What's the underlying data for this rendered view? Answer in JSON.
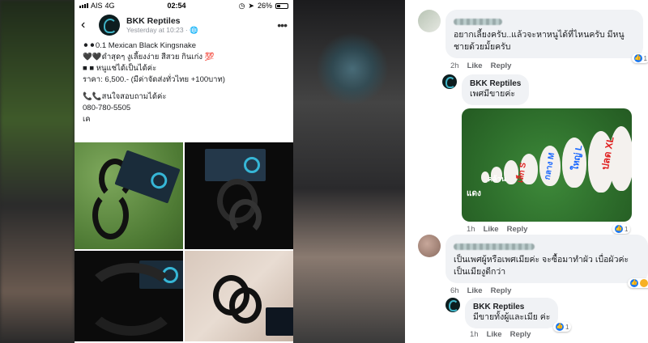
{
  "status_bar": {
    "carrier": "AIS",
    "network": "4G",
    "time": "02:54",
    "battery": "26%"
  },
  "post": {
    "page_name": "BKK Reptiles",
    "time": "Yesterday at 10:23 · ",
    "lines": [
      "⚫⚫0.1 Mexican Black Kingsnake",
      "🖤🖤ดำสุดๆ งูเลี้ยงง่าย สีสวย กินเก่ง 💯",
      "■ ■ หนูแช่ได้เป็นได้ค่ะ",
      "ราคา: 6,500.- (มีค่าจัดส่งทั่วไทย +100บาท)",
      "📞📞สนใจสอบถามได้ค่ะ",
      "080-780-5505",
      "เค"
    ]
  },
  "comments": [
    {
      "text": [
        "อยากเลี้ยงครับ..แล้วจะหาหนูได้ที่ไหนครับ มีหนู",
        "ชายด้วยมั้ยครับ"
      ],
      "time": "2h",
      "like": "Like",
      "reply": "Reply",
      "reactions": "1"
    },
    {
      "author": "BKK Reptiles",
      "text": [
        "เพศมีขายค่ะ"
      ],
      "time": "1h",
      "like": "Like",
      "reply": "Reply",
      "reactions": "1",
      "photo_labels": [
        "แดง",
        "คล้าน",
        "เล็ก S",
        "กลาง M",
        "ใหญ่ L",
        "ปลด XL"
      ]
    },
    {
      "text": [
        "เป็นเพศผู้หรือเพศเมียค่ะ จะซื้อมาทำผัว เบื่อผัวค่ะ",
        "เป็นเมียงูดีกว่า"
      ],
      "time": "6h",
      "like": "Like",
      "reply": "Reply",
      "reactions": "10"
    },
    {
      "author": "BKK Reptiles",
      "text": [
        "มีขายทั้งผู้และเมีย ค่ะ"
      ],
      "time": "1h",
      "like": "Like",
      "reply": "Reply",
      "reactions": "1"
    }
  ],
  "colors": {
    "like_blue": "#1877f2",
    "bubble_gray": "#f0f2f5",
    "label_blue": "#1565ff",
    "label_red": "#e02020"
  }
}
